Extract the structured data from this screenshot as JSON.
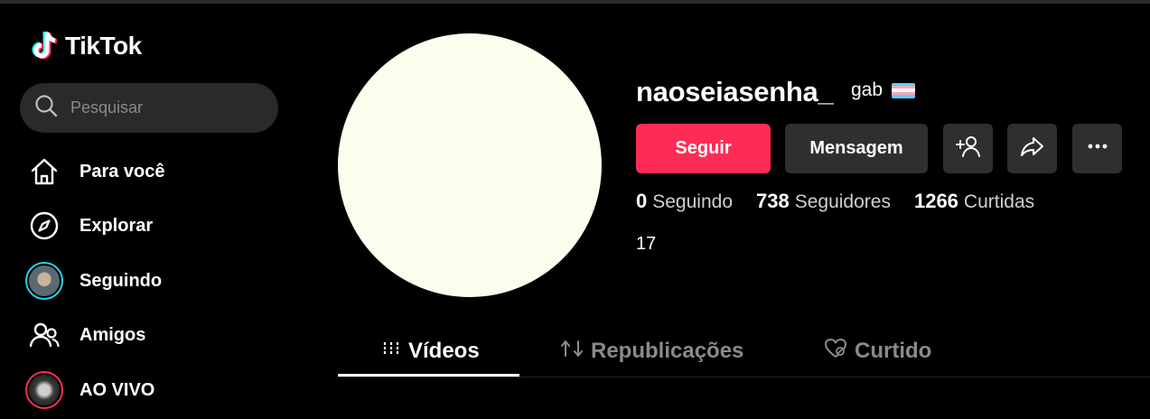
{
  "app": {
    "name": "TikTok"
  },
  "search": {
    "placeholder": "Pesquisar"
  },
  "sidebar": {
    "items": [
      {
        "label": "Para você",
        "icon": "home-icon"
      },
      {
        "label": "Explorar",
        "icon": "compass-icon"
      },
      {
        "label": "Seguindo",
        "icon": "avatar"
      },
      {
        "label": "Amigos",
        "icon": "friends-icon"
      },
      {
        "label": "AO VIVO",
        "icon": "live-avatar"
      }
    ]
  },
  "profile": {
    "username": "naoseiasenha_",
    "nickname": "gab",
    "flag_colors": [
      "#5bcefa",
      "#f5a9b8",
      "#ffffff",
      "#f5a9b8",
      "#5bcefa"
    ],
    "follow_label": "Seguir",
    "message_label": "Mensagem",
    "stats": {
      "following_count": "0",
      "following_label": "Seguindo",
      "followers_count": "738",
      "followers_label": "Seguidores",
      "likes_count": "1266",
      "likes_label": "Curtidas"
    },
    "bio": "17"
  },
  "tabs": [
    {
      "label": "Vídeos",
      "icon": "grid-icon",
      "active": true
    },
    {
      "label": "Republicações",
      "icon": "repost-icon",
      "active": false
    },
    {
      "label": "Curtido",
      "icon": "heart-hidden-icon",
      "active": false
    }
  ],
  "colors": {
    "accent": "#fe2c55",
    "background": "#000000",
    "button": "#2f2f2f"
  }
}
